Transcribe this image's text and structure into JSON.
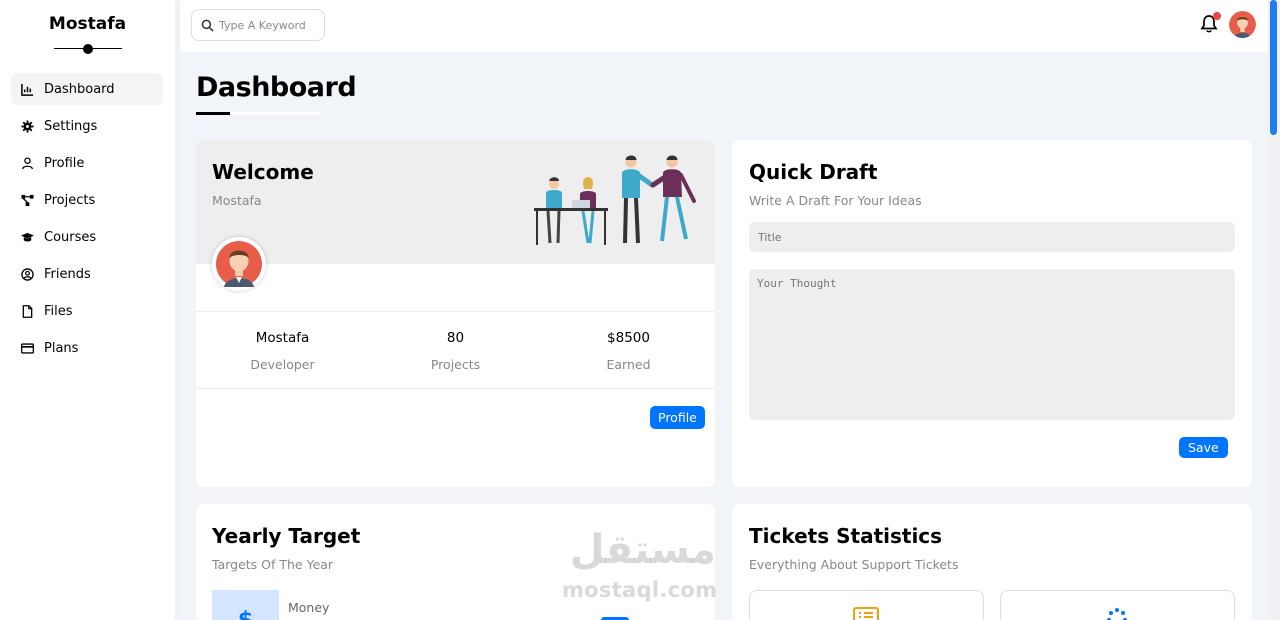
{
  "sidebar": {
    "brand": "Mostafa",
    "items": [
      {
        "label": "Dashboard",
        "icon": "chart-icon",
        "active": true
      },
      {
        "label": "Settings",
        "icon": "gear-icon"
      },
      {
        "label": "Profile",
        "icon": "user-icon"
      },
      {
        "label": "Projects",
        "icon": "diagram-icon"
      },
      {
        "label": "Courses",
        "icon": "graduation-cap-icon"
      },
      {
        "label": "Friends",
        "icon": "user-circle-icon"
      },
      {
        "label": "Files",
        "icon": "file-icon"
      },
      {
        "label": "Plans",
        "icon": "credit-card-icon"
      }
    ]
  },
  "header": {
    "search_placeholder": "Type A Keyword",
    "notification_dot_color": "#ef4444"
  },
  "page": {
    "title": "Dashboard"
  },
  "welcome": {
    "title": "Welcome",
    "name": "Mostafa",
    "stats": [
      {
        "value": "Mostafa",
        "label": "Developer"
      },
      {
        "value": "80",
        "label": "Projects"
      },
      {
        "value": "$8500",
        "label": "Earned"
      }
    ],
    "button": "Profile"
  },
  "draft": {
    "title": "Quick Draft",
    "subtitle": "Write A Draft For Your Ideas",
    "title_placeholder": "Title",
    "thought_placeholder": "Your Thought",
    "button": "Save"
  },
  "yearly": {
    "title": "Yearly Target",
    "subtitle": "Targets Of The Year",
    "item_label": "Money",
    "item_icon_glyph": "$"
  },
  "tickets": {
    "title": "Tickets Statistics",
    "subtitle": "Everything About Support Tickets"
  },
  "watermark": {
    "arabic": "مستقل",
    "latin": "mostaql.com"
  },
  "colors": {
    "accent": "#0075ff",
    "page_bg": "#f1f5f9",
    "ticket_icon_orange": "#f59e0b"
  }
}
